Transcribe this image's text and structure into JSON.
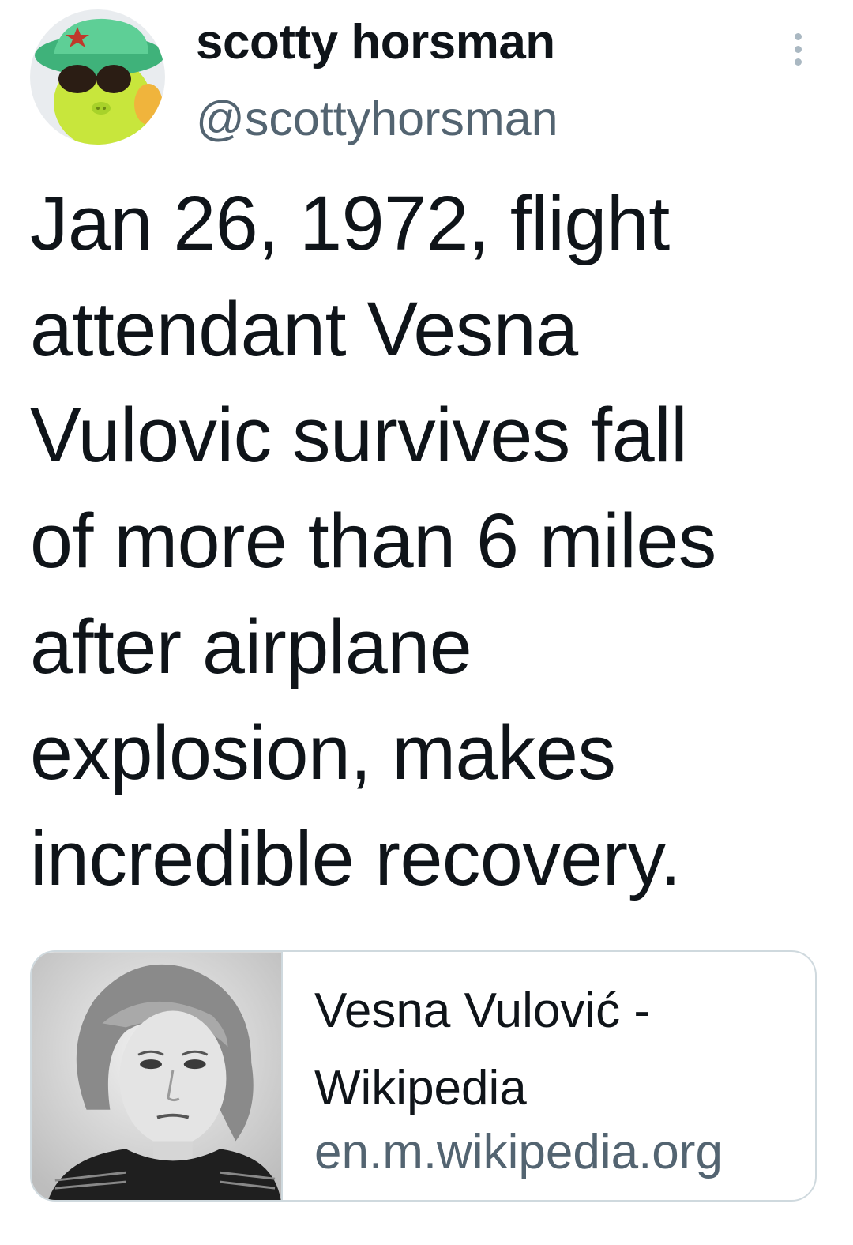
{
  "author": {
    "display_name": "scotty horsman",
    "handle": "@scottyhorsman",
    "avatar_icon": "cartoon-character-avatar"
  },
  "more_icon": "more-options-icon",
  "tweet": {
    "text_lines": [
      "Jan 26, 1972, flight",
      "attendant Vesna",
      "Vulovic survives fall",
      "of more than 6 miles",
      "after airplane",
      "explosion, makes",
      "incredible recovery."
    ]
  },
  "link_card": {
    "title_lines": [
      "Vesna Vulović -",
      "Wikipedia"
    ],
    "domain": "en.m.wikipedia.org",
    "image": "black-and-white-portrait-photo"
  },
  "colors": {
    "text_primary": "#0f1419",
    "text_secondary": "#536471",
    "border": "#cfd9de"
  }
}
